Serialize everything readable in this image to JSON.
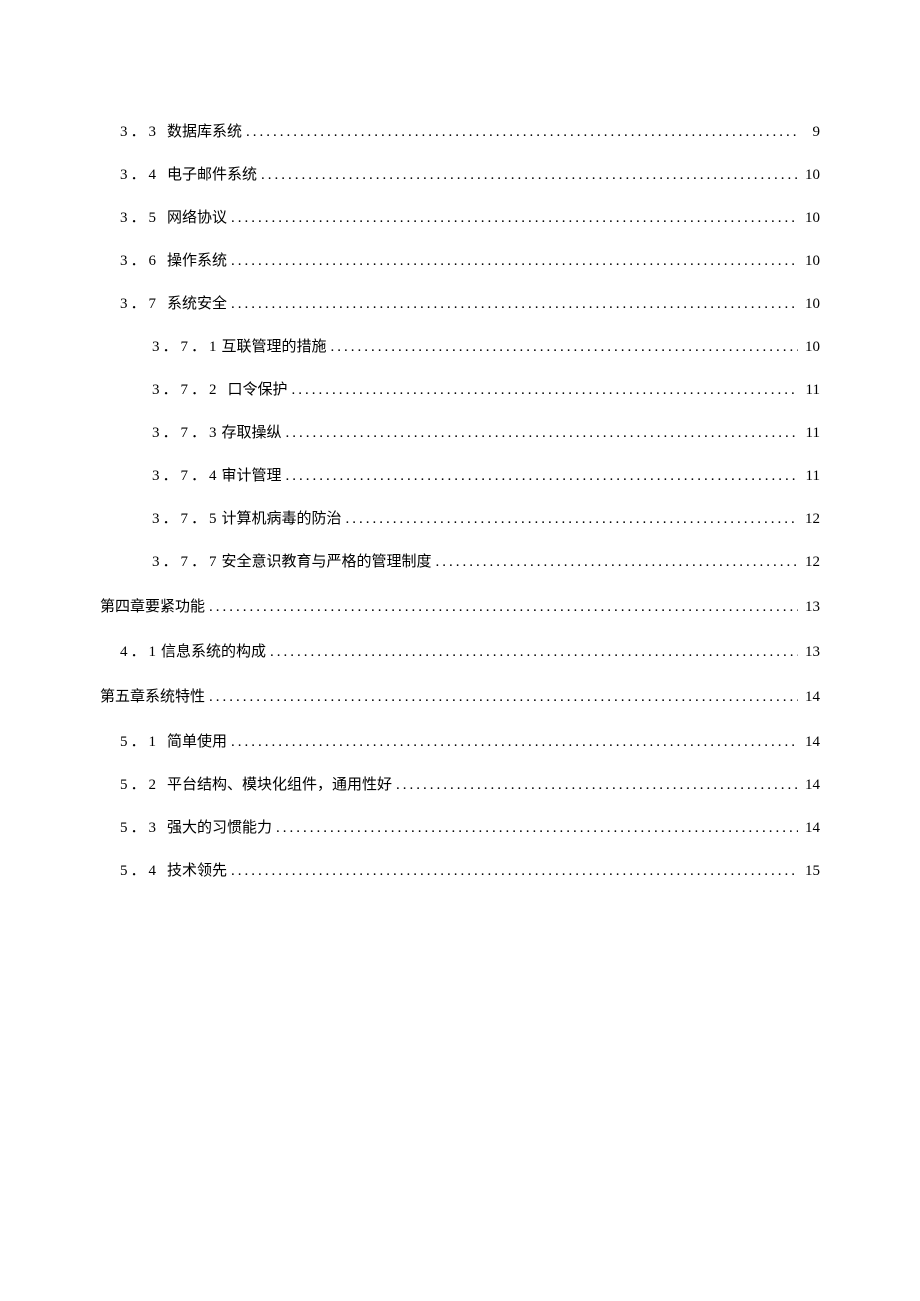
{
  "toc": [
    {
      "level": 1,
      "num": "3．3",
      "title": "数据库系统",
      "page": "9",
      "spaced": true
    },
    {
      "level": 1,
      "num": "3．4",
      "title": "电子邮件系统",
      "page": "10",
      "spaced": true
    },
    {
      "level": 1,
      "num": "3．5",
      "title": "网络协议",
      "page": "10",
      "spaced": true
    },
    {
      "level": 1,
      "num": "3．6",
      "title": "操作系统",
      "page": "10",
      "spaced": true
    },
    {
      "level": 1,
      "num": "3．7",
      "title": "系统安全",
      "page": "10",
      "spaced": true
    },
    {
      "level": 2,
      "num": "3．7．1",
      "title": "互联管理的措施",
      "page": "10",
      "spaced": false
    },
    {
      "level": 2,
      "num": "3．7．2",
      "title": " 口令保护",
      "page": "11",
      "spaced": true
    },
    {
      "level": 2,
      "num": "3．7．3",
      "title": "存取操纵",
      "page": "11",
      "spaced": false
    },
    {
      "level": 2,
      "num": "3．7．4",
      "title": "审计管理",
      "page": "11",
      "spaced": false
    },
    {
      "level": 2,
      "num": "3．7．5",
      "title": "计算机病毒的防治",
      "page": "12",
      "spaced": false
    },
    {
      "level": 2,
      "num": "3．7．7",
      "title": "安全意识教育与严格的管理制度",
      "page": "12",
      "spaced": false
    },
    {
      "level": 0,
      "num": "",
      "title": "第四章要紧功能",
      "page": "13",
      "spaced": false
    },
    {
      "level": 1,
      "num": "4．1",
      "title": "信息系统的构成",
      "page": "13",
      "spaced": false
    },
    {
      "level": 0,
      "num": "",
      "title": "第五章系统特性",
      "page": "14",
      "spaced": false
    },
    {
      "level": 1,
      "num": "5．1",
      "title": "简单使用",
      "page": "14",
      "spaced": true
    },
    {
      "level": 1,
      "num": "5．2",
      "title": "平台结构、模块化组件，通用性好",
      "page": "14",
      "spaced": true
    },
    {
      "level": 1,
      "num": "5．3",
      "title": "强大的习惯能力",
      "page": "14",
      "spaced": true
    },
    {
      "level": 1,
      "num": "5．4",
      "title": "技术领先",
      "page": "15",
      "spaced": true
    }
  ]
}
